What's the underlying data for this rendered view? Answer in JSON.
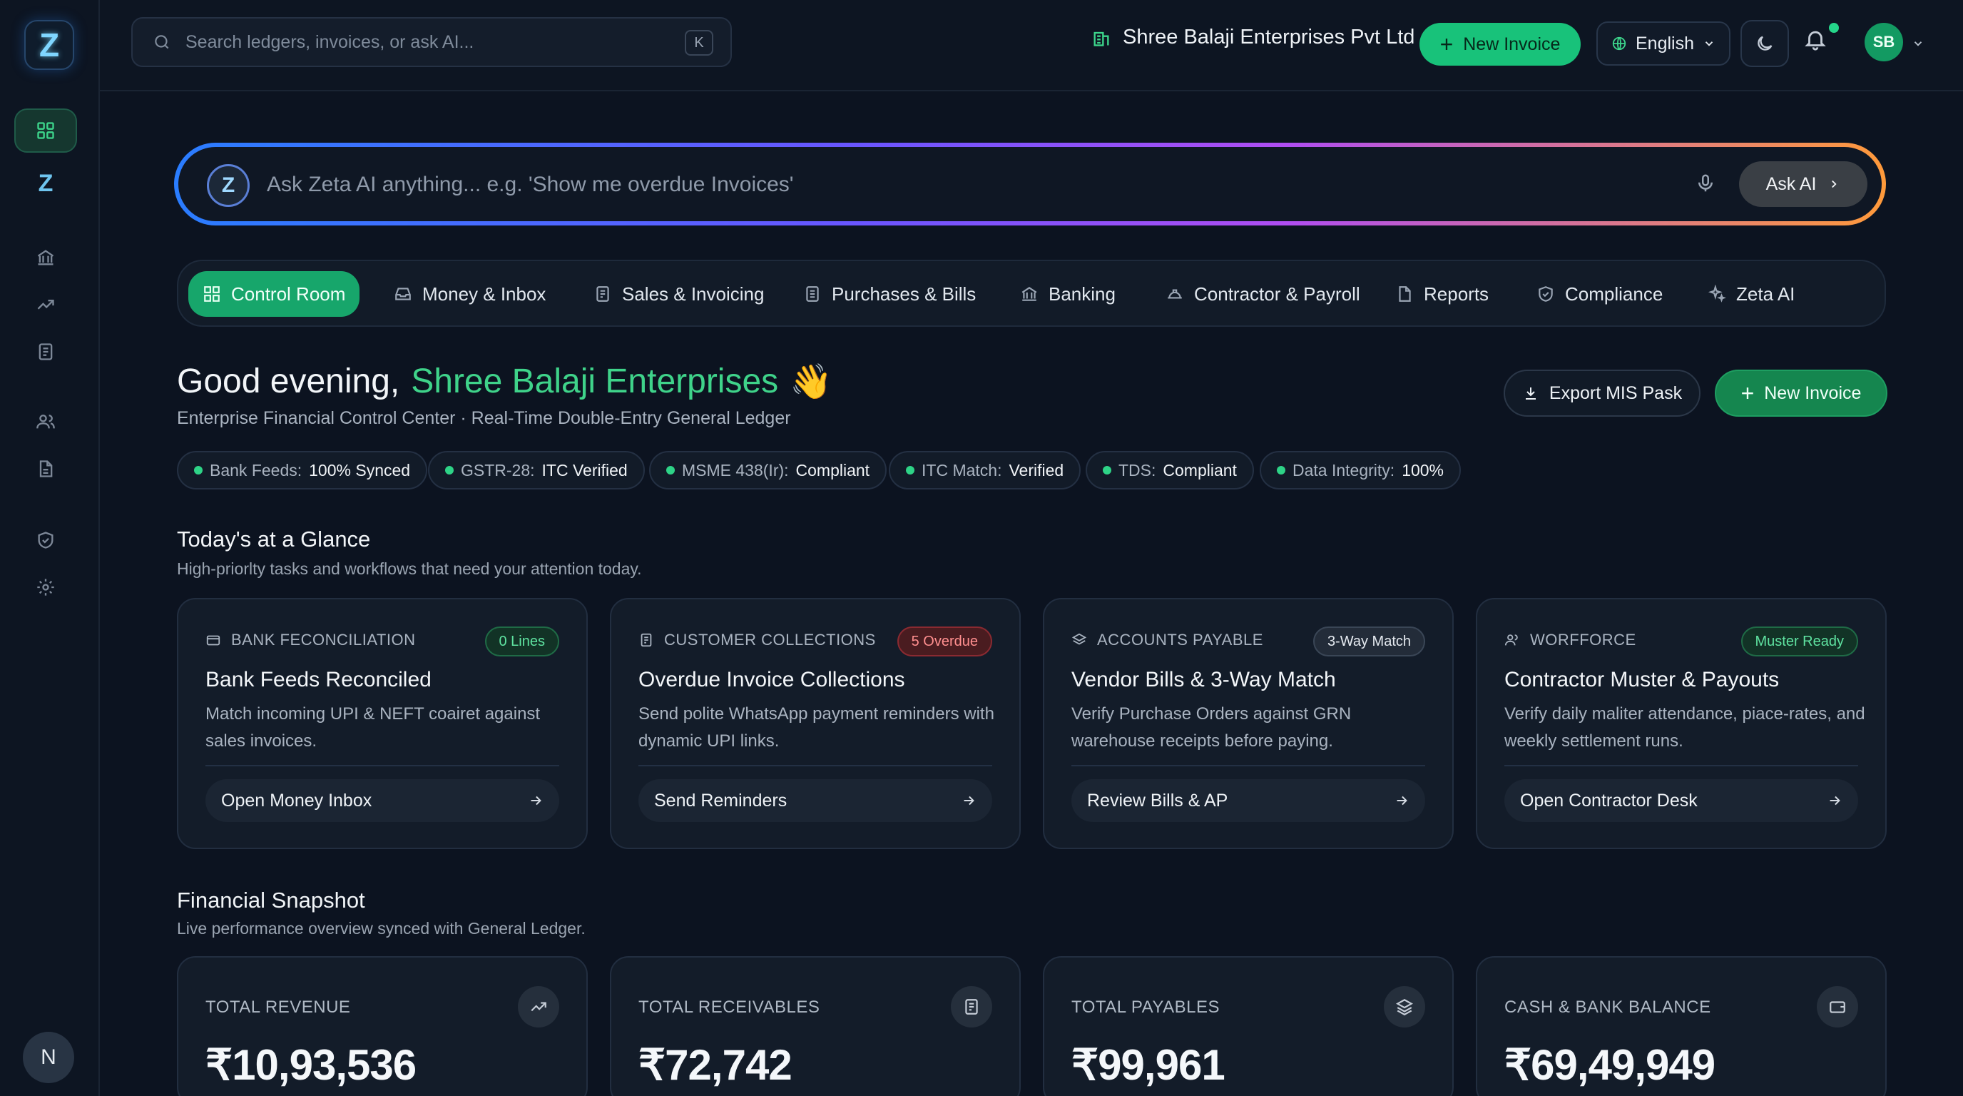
{
  "app": {
    "logo_letter": "Z",
    "user_initial": "N"
  },
  "sidebar": {
    "items": [
      "dashboard-grid-icon",
      "zeta-logo-icon",
      "bank-icon",
      "trend-icon",
      "ledger-icon",
      "users-icon",
      "document-icon",
      "shield-icon",
      "gear-icon"
    ]
  },
  "topbar": {
    "search_placeholder": "Search ledgers, invoices, or ask AI...",
    "search_shortcut": "K",
    "company": "Shree Balaji Enterprises Pvt Ltd",
    "new_invoice": "New Invoice",
    "language": "English",
    "avatar_initials": "SB"
  },
  "ai": {
    "logo_letter": "Z",
    "placeholder": "Ask Zeta AI anything... e.g. 'Show me overdue Invoices'",
    "button": "Ask AI"
  },
  "tabs": [
    {
      "label": "Control Room"
    },
    {
      "label": "Money & Inbox"
    },
    {
      "label": "Sales & Invoicing"
    },
    {
      "label": "Purchases & Bills"
    },
    {
      "label": "Banking"
    },
    {
      "label": "Contractor & Payroll"
    },
    {
      "label": "Reports"
    },
    {
      "label": "Compliance"
    },
    {
      "label": "Zeta AI"
    }
  ],
  "greeting": {
    "prefix": "Good evening,",
    "name": "Shree Balaji Enterprises",
    "emoji": "👋",
    "subtitle": "Enterprise Financial Control Center · Real-Time Double-Entry General Ledger"
  },
  "actions": {
    "export": "Export MIS Pask",
    "new_invoice": "New Invoice"
  },
  "badges": [
    {
      "label": "Bank Feeds:",
      "value": "100% Synced"
    },
    {
      "label": "GSTR-28:",
      "value": "ITC Verified"
    },
    {
      "label": "MSME 438(Ir):",
      "value": "Compliant"
    },
    {
      "label": "ITC Match:",
      "value": "Verified"
    },
    {
      "label": "TDS:",
      "value": "Compliant"
    },
    {
      "label": "Data Integrity:",
      "value": "100%"
    }
  ],
  "glance": {
    "title": "Today's at a Glance",
    "subtitle": "High-priorlty tasks and workflows that need your attention today.",
    "cards": [
      {
        "kicker": "BANK FECONCILIATION",
        "pill": "0 Lines",
        "title": "Bank Feeds Reconciled",
        "desc": "Match incoming UPI & NEFT coairet against sales invoices.",
        "action": "Open Money Inbox"
      },
      {
        "kicker": "CUSTOMER COLLECTIONS",
        "pill": "5 Overdue",
        "title": "Overdue Invoice Collections",
        "desc": "Send polite WhatsApp payment reminders with dynamic UPI links.",
        "action": "Send Reminders"
      },
      {
        "kicker": "ACCOUNTS PAYABLE",
        "pill": "3-Way Match",
        "title": "Vendor Bills & 3-Way Match",
        "desc": "Verify Purchase Orders against GRN warehouse receipts before paying.",
        "action": "Review Bills & AP"
      },
      {
        "kicker": "WORFFORCE",
        "pill": "Muster Ready",
        "title": "Contractor Muster & Payouts",
        "desc": "Verify daily maliter attendance, piace-rates, and weekly settlement runs.",
        "action": "Open Contractor Desk"
      }
    ]
  },
  "snapshot": {
    "title": "Financial Snapshot",
    "subtitle": "Live performance overview synced with General Ledger.",
    "cards": [
      {
        "label": "TOTAL REVENUE",
        "value": "₹10,93,536"
      },
      {
        "label": "TOTAL RECEIVABLES",
        "value": "₹72,742"
      },
      {
        "label": "TOTAL PAYABLES",
        "value": "₹99,961"
      },
      {
        "label": "CASH & BANK BALANCE",
        "value": "₹69,49,949"
      }
    ]
  },
  "colors": {
    "accent": "#18c27a",
    "background": "#0c1320",
    "danger": "#ff8f8f"
  }
}
